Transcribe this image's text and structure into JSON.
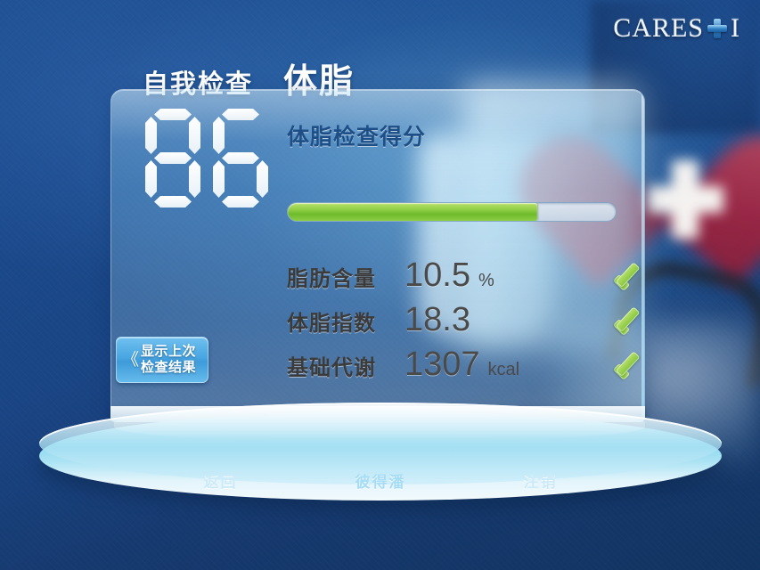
{
  "brand": {
    "name": "CARES",
    "suffix": "I",
    "cross_icon": "medical-cross-icon"
  },
  "header": {
    "section": "自我检查",
    "title": "体脂"
  },
  "score": {
    "value": "86",
    "digits": [
      "8",
      "6"
    ],
    "label": "体脂检查得分",
    "progress_percent": 76
  },
  "metrics": [
    {
      "label": "脂肪含量",
      "value": "10.5",
      "unit": "%",
      "status": "ok"
    },
    {
      "label": "体脂指数",
      "value": "18.3",
      "unit": "",
      "status": "ok"
    },
    {
      "label": "基础代谢",
      "value": "1307",
      "unit": "kcal",
      "status": "ok"
    }
  ],
  "last_result_button": {
    "chevron": "《",
    "line1": "显示上次",
    "line2": "检查结果"
  },
  "nav": {
    "back": "返回",
    "user": "彼得潘",
    "logout": "注销"
  },
  "colors": {
    "accent_green": "#8fce45",
    "panel_blue": "#8ccdf0",
    "label_blue": "#1d4e86",
    "background_blue": "#1a4584"
  }
}
